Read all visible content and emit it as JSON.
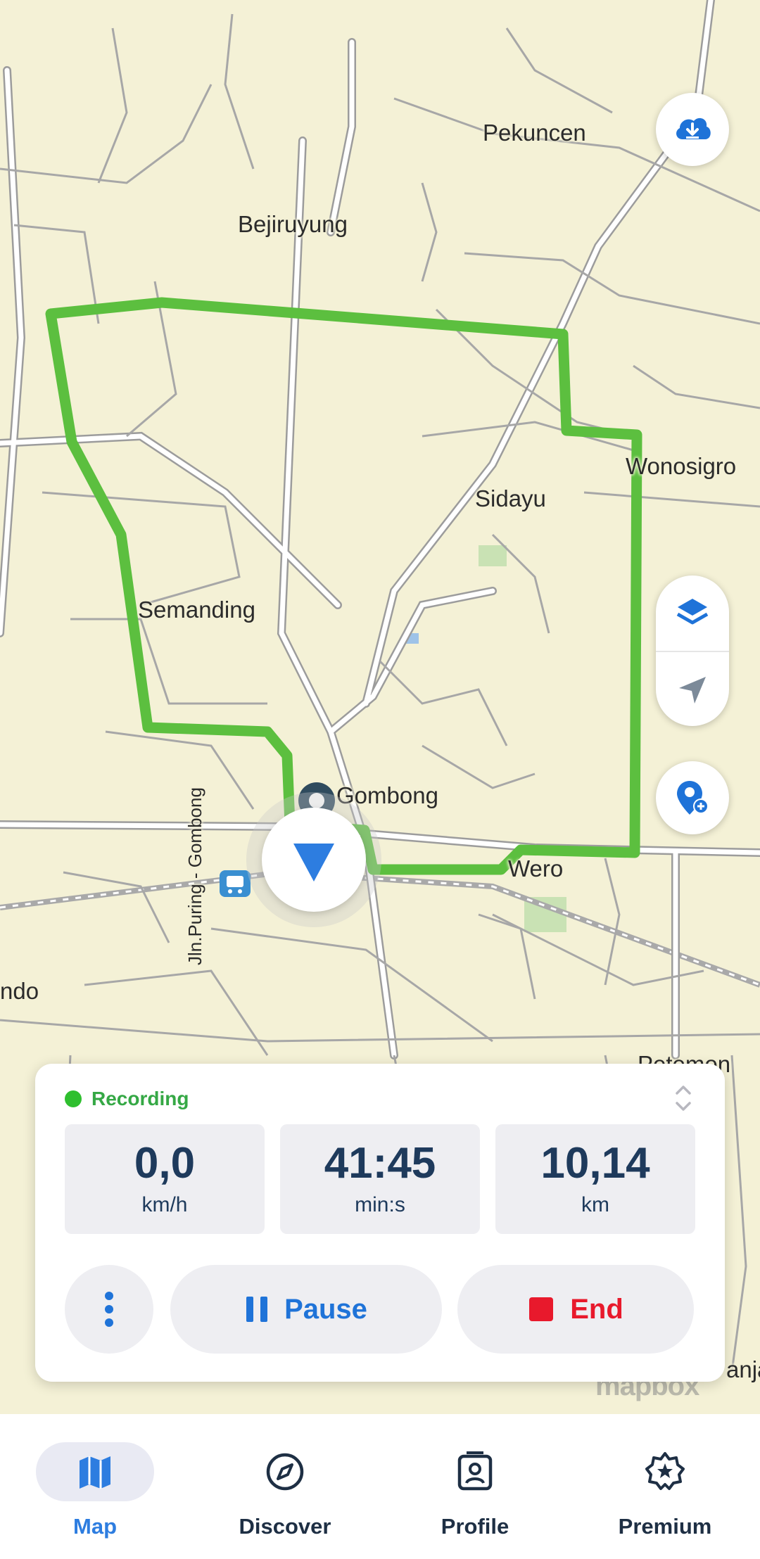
{
  "map": {
    "places": [
      "Pekuncen",
      "Bejiruyung",
      "Wonosigro",
      "Sidayu",
      "Semanding",
      "Gombong",
      "Wero",
      "ndo",
      "Petemon",
      "anja"
    ],
    "road_label": "Jln.Puring - Gombong",
    "attribution": "mapbox",
    "route_color": "#5cbf3f"
  },
  "controls": {
    "download_icon": "cloud-download-icon",
    "layers_icon": "layers-icon",
    "locate_icon": "navigation-arrow-icon",
    "add_place_icon": "add-location-icon"
  },
  "recording": {
    "status": "Recording",
    "speed": {
      "value": "0,0",
      "unit": "km/h"
    },
    "duration": {
      "value": "41:45",
      "unit": "min:s"
    },
    "distance": {
      "value": "10,14",
      "unit": "km"
    },
    "pause_label": "Pause",
    "end_label": "End"
  },
  "tabs": [
    {
      "label": "Map",
      "icon": "map-icon",
      "active": true
    },
    {
      "label": "Discover",
      "icon": "compass-icon",
      "active": false
    },
    {
      "label": "Profile",
      "icon": "profile-badge-icon",
      "active": false
    },
    {
      "label": "Premium",
      "icon": "premium-star-icon",
      "active": false
    }
  ],
  "colors": {
    "accent": "#2d7de0",
    "recording": "#35a845",
    "end": "#e8192c",
    "stat_text": "#1e3a5c"
  }
}
